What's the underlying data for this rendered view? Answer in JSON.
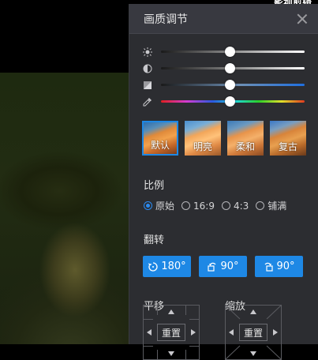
{
  "window": {
    "top_right_text": "影视剪辑"
  },
  "panel": {
    "title": "画质调节",
    "sliders": [
      {
        "name": "brightness",
        "icon": "brightness-icon",
        "value": 0.48
      },
      {
        "name": "contrast",
        "icon": "contrast-icon",
        "value": 0.48
      },
      {
        "name": "saturation",
        "icon": "saturation-icon",
        "value": 0.48
      },
      {
        "name": "hue",
        "icon": "eyedropper-icon",
        "value": 0.48
      }
    ],
    "presets": [
      {
        "label": "默认",
        "selected": true
      },
      {
        "label": "明亮",
        "selected": false
      },
      {
        "label": "柔和",
        "selected": false
      },
      {
        "label": "复古",
        "selected": false
      }
    ],
    "ratio": {
      "title": "比例",
      "options": [
        {
          "label": "原始",
          "checked": true
        },
        {
          "label": "16:9",
          "checked": false
        },
        {
          "label": "4:3",
          "checked": false
        },
        {
          "label": "铺满",
          "checked": false
        }
      ]
    },
    "flip": {
      "title": "翻转",
      "buttons": [
        {
          "label": "180°",
          "icon": "rotate-180-icon"
        },
        {
          "label": "90°",
          "icon": "rotate-left-90-icon"
        },
        {
          "label": "90°",
          "icon": "rotate-right-90-icon"
        }
      ]
    },
    "pan": {
      "title": "平移",
      "reset": "重置"
    },
    "zoom": {
      "title": "缩放",
      "reset": "重置"
    }
  },
  "colors": {
    "accent": "#1e88e5",
    "panel_bg": "#2c2d31",
    "header_bg": "#383940"
  }
}
